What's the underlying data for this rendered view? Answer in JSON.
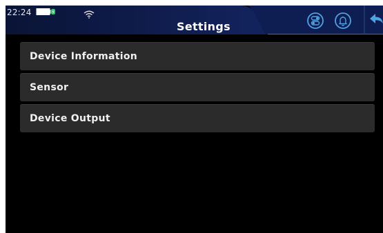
{
  "status_bar": {
    "time": "22:24",
    "battery_icon": "battery-charging-icon",
    "wifi_icon": "wifi-icon"
  },
  "header": {
    "title": "Settings",
    "icons": [
      "toggle-settings-icon",
      "bell-icon",
      "back-arrow-icon"
    ]
  },
  "menu": {
    "items": [
      {
        "label": "Device Information"
      },
      {
        "label": "Sensor"
      },
      {
        "label": "Device Output"
      }
    ]
  },
  "colors": {
    "header_bg": "#0d1a4a",
    "accent": "#4fa3e3",
    "menu_bg": "#2b2b2b",
    "screen_bg": "#000000"
  }
}
